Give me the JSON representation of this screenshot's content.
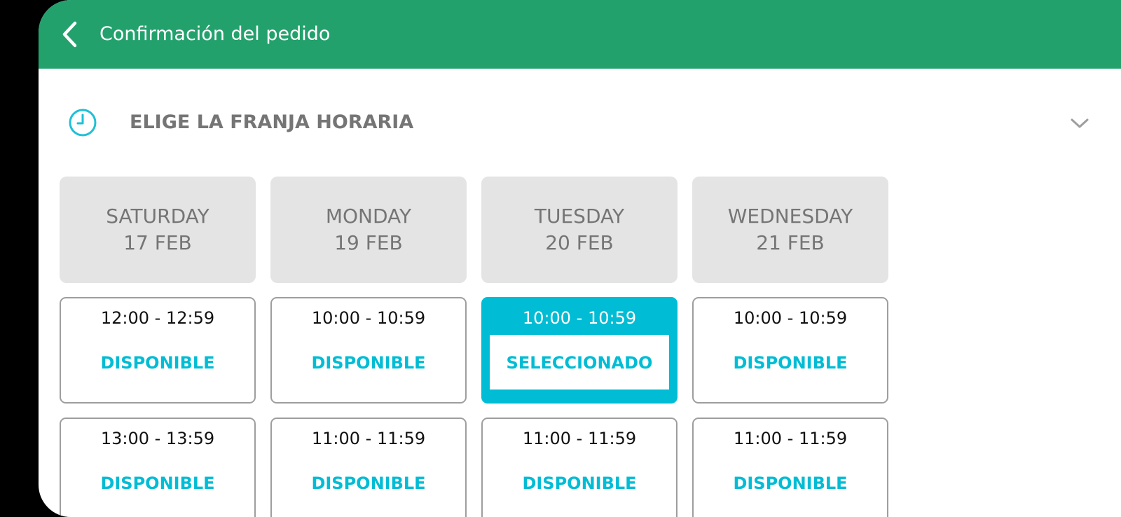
{
  "appbar": {
    "title": "Confirmación del pedido",
    "back_icon": "chevron-left-icon",
    "color": "#23a16c"
  },
  "section": {
    "icon": "clock-icon",
    "title": "ELIGE LA FRANJA HORARIA",
    "expand_icon": "chevron-down-icon"
  },
  "colors": {
    "accent": "#00bcd4",
    "day_header_bg": "#e4e4e4"
  },
  "days": [
    {
      "weekday": "SATURDAY",
      "date": "17 FEB",
      "slots": [
        {
          "time": "12:00 - 12:59",
          "status": "DISPONIBLE",
          "selected": false
        },
        {
          "time": "13:00 - 13:59",
          "status": "DISPONIBLE",
          "selected": false
        }
      ]
    },
    {
      "weekday": "MONDAY",
      "date": "19 FEB",
      "slots": [
        {
          "time": "10:00 - 10:59",
          "status": "DISPONIBLE",
          "selected": false
        },
        {
          "time": "11:00 - 11:59",
          "status": "DISPONIBLE",
          "selected": false
        }
      ]
    },
    {
      "weekday": "TUESDAY",
      "date": "20 FEB",
      "slots": [
        {
          "time": "10:00 - 10:59",
          "status": "SELECCIONADO",
          "selected": true
        },
        {
          "time": "11:00 - 11:59",
          "status": "DISPONIBLE",
          "selected": false
        }
      ]
    },
    {
      "weekday": "WEDNESDAY",
      "date": "21 FEB",
      "slots": [
        {
          "time": "10:00 - 10:59",
          "status": "DISPONIBLE",
          "selected": false
        },
        {
          "time": "11:00 - 11:59",
          "status": "DISPONIBLE",
          "selected": false
        }
      ]
    }
  ]
}
